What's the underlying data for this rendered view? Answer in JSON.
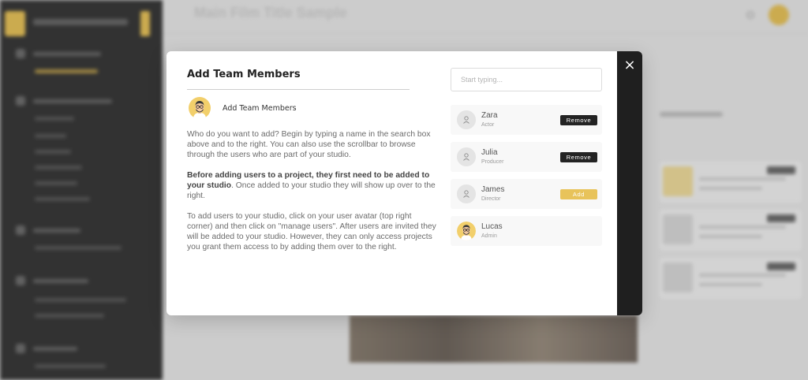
{
  "background": {
    "page_title": "Main Film Title Sample"
  },
  "modal": {
    "title": "Add Team Members",
    "header_label": "Add Team Members",
    "close_symbol": "×",
    "description": {
      "p1": "Who do you want to add? Begin by typing a name in the search box above and to the right. You can also use the scrollbar to browse through the users who are part of your studio.",
      "p2_bold": "Before adding users to a project, they first need to be added to your studio",
      "p2_rest": ". Once added to your studio they will show up over to the right.",
      "p3": "To add users to your studio, click on your user avatar (top right corner) and then click on \"manage users\". After users are invited they will be added to your studio. However, they can only access projects you grant them access to by adding them over to the right."
    },
    "search": {
      "placeholder": "Start typing..."
    },
    "users": [
      {
        "name": "Zara",
        "role": "Actor",
        "action": "Remove",
        "avatar": "user-placeholder-icon"
      },
      {
        "name": "Julia",
        "role": "Producer",
        "action": "Remove",
        "avatar": "user-placeholder-icon"
      },
      {
        "name": "James",
        "role": "Director",
        "action": "Add",
        "avatar": "user-placeholder-icon"
      },
      {
        "name": "Lucas",
        "role": "Admin",
        "action": "",
        "avatar": "cartoon-avatar"
      }
    ]
  },
  "colors": {
    "accent": "#e8c35a",
    "dark": "#232323",
    "side_panel": "#1f1f1f"
  }
}
